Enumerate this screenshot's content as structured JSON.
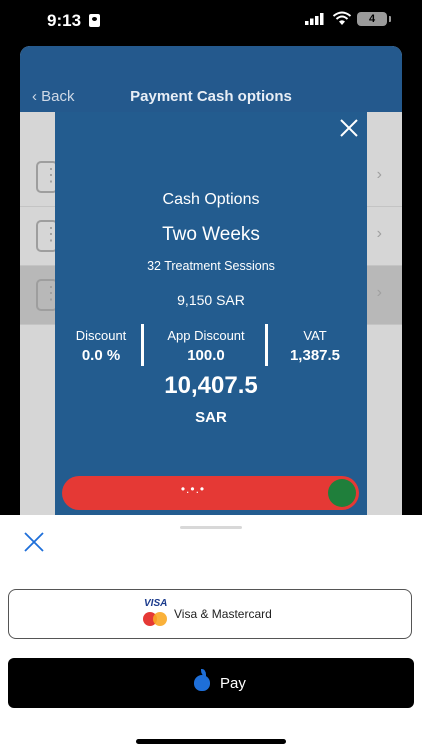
{
  "status_bar": {
    "time": "9:13",
    "battery": "4"
  },
  "background_screen": {
    "back_label": "Back",
    "title": "Payment Cash options",
    "rows": [
      {},
      {},
      {}
    ]
  },
  "modal": {
    "heading": "Cash Options",
    "plan": "Two Weeks",
    "sessions": "32 Treatment Sessions",
    "price": "9,150 SAR",
    "discount_label": "Discount",
    "discount_value": "0.0 %",
    "app_discount_label": "App Discount",
    "app_discount_value": "100.0",
    "vat_label": "VAT",
    "vat_value": "1,387.5",
    "total": "10,407.5",
    "currency": "SAR",
    "slider_text": "•.•.•",
    "colors": {
      "modal_bg": "#235c8f",
      "slider": "#e53935",
      "knob": "#1f7f3b"
    }
  },
  "payment_sheet": {
    "visa_badge": "VISA",
    "visa_mastercard_label": "Visa & Mastercard",
    "apple_pay_label": "Pay"
  }
}
